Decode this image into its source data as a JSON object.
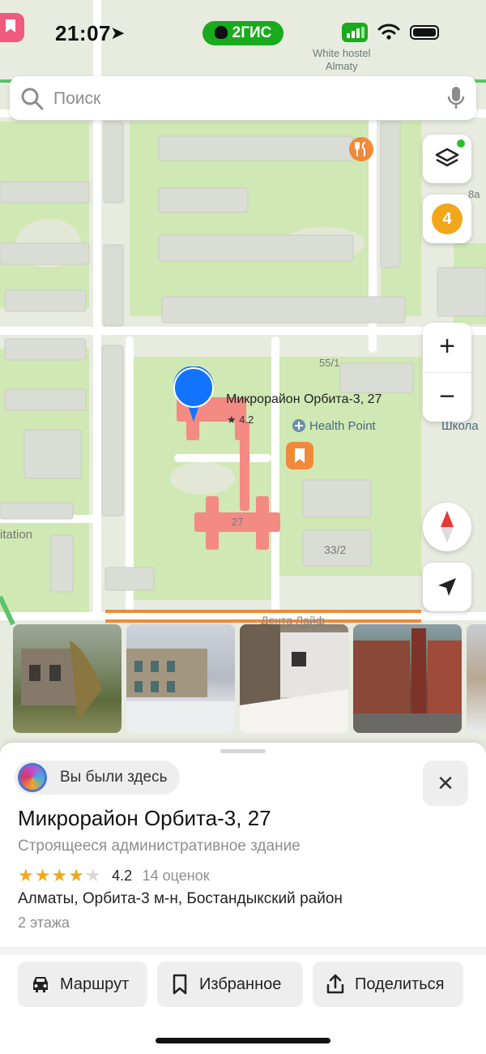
{
  "status_bar": {
    "time": "21:07",
    "brand": "2ГИС"
  },
  "map": {
    "top_poi": "White hostel\nAlmaty",
    "selected_place_label": "Микрорайон Орбита-3, 27",
    "selected_rating": "★ 4.2",
    "health_point": "Health Point",
    "school_label": "Школа",
    "building_labels": {
      "b55": "55/1",
      "b27": "27",
      "b33": "33/2",
      "b8a": "8а"
    },
    "bottom_street": "Дента Лайф",
    "edge_left_label": "itation",
    "traffic_level": "4"
  },
  "search": {
    "placeholder": "Поиск"
  },
  "controls": {
    "zoom_in": "+",
    "zoom_out": "−"
  },
  "card": {
    "visited_label": "Вы были здесь",
    "close_label": "✕",
    "title": "Микрорайон Орбита-3, 27",
    "subtitle": "Строящееся административное здание",
    "rating_value": "4.2",
    "rating_count": "14 оценок",
    "rating_stars": 4.2,
    "address": "Алматы, Орбита-3 м-н, Бостандыкский район",
    "floors": "2 этажа"
  },
  "actions": [
    {
      "label": "Маршрут",
      "icon": "car-icon"
    },
    {
      "label": "Избранное",
      "icon": "bookmark-icon"
    },
    {
      "label": "Поделиться",
      "icon": "share-icon"
    }
  ],
  "colors": {
    "accent_green": "#19aa1e",
    "pin_blue": "#1273ff",
    "building_highlight": "#f48a84",
    "star": "#f2a71b"
  }
}
